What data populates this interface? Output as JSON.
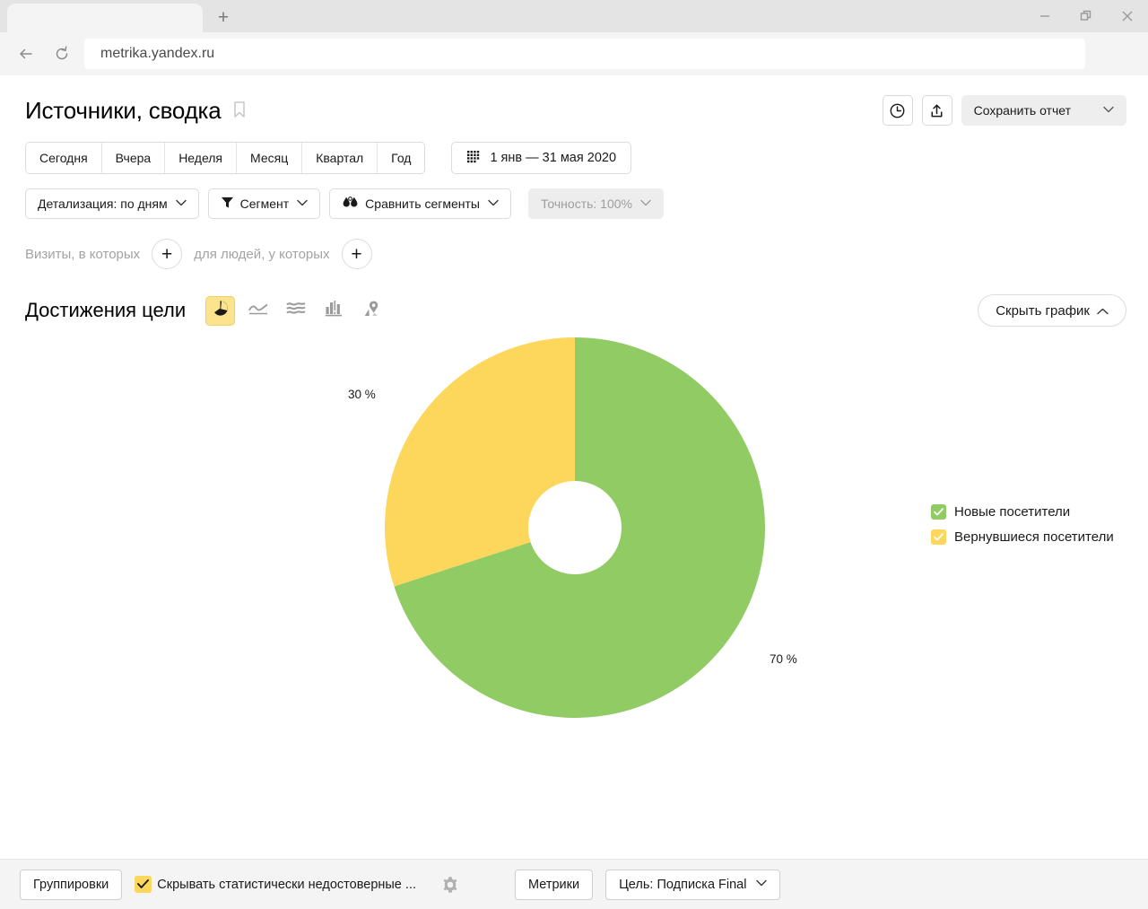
{
  "browser": {
    "tab_title": "",
    "newtab_label": "+",
    "url": "metrika.yandex.ru",
    "back_icon": "back-arrow-icon",
    "reload_icon": "reload-icon",
    "minimize_label": "–",
    "restore_label": "❐",
    "close_label": "✕"
  },
  "header": {
    "page_title": "Источники, сводка",
    "bookmark_icon": "bookmark-icon",
    "history_icon": "clock-icon",
    "share_icon": "share-icon",
    "save_report_label": "Сохранить отчет",
    "save_report_chevron": "⌄"
  },
  "period": {
    "buttons": [
      {
        "label": "Сегодня"
      },
      {
        "label": "Вчера"
      },
      {
        "label": "Неделя"
      },
      {
        "label": "Месяц"
      },
      {
        "label": "Квартал"
      },
      {
        "label": "Год"
      }
    ],
    "daterange_icon": "calendar-icon",
    "daterange_label": "1 янв — 31 мая 2020"
  },
  "tools": {
    "detail_label": "Детализация: по дням",
    "segment_icon": "funnel-icon",
    "segment_label": "Сегмент",
    "compare_icon": "droplets-icon",
    "compare_label": "Сравнить сегменты",
    "accuracy_label": "Точность: 100%",
    "chevron": "⌄"
  },
  "filters": {
    "visits_label": "Визиты, в которых",
    "people_label": "для людей, у которых",
    "add_label": "+"
  },
  "chart_section": {
    "title": "Достижения цели",
    "type_buttons": [
      {
        "name": "pie-chart-icon",
        "active": true
      },
      {
        "name": "line-chart-icon",
        "active": false
      },
      {
        "name": "area-chart-icon",
        "active": false
      },
      {
        "name": "bar-chart-icon",
        "active": false
      },
      {
        "name": "map-chart-icon",
        "active": false
      }
    ],
    "hide_chart_label": "Скрыть график",
    "hide_chart_chevron": "⌃"
  },
  "chart_data": {
    "type": "pie",
    "title": "Достижения цели",
    "donut": true,
    "categories": [
      "Новые посетители",
      "Вернувшиеся посетители"
    ],
    "values": [
      70,
      30
    ],
    "labels": [
      "70 %",
      "30 %"
    ],
    "colors": [
      "#90cc63",
      "#fcd75b"
    ],
    "legend_position": "right",
    "start_angle": 0,
    "direction": "clockwise"
  },
  "legend": {
    "items": [
      {
        "label": "Новые посетители",
        "color": "#90cc63",
        "checked": true
      },
      {
        "label": "Вернувшиеся посетители",
        "color": "#fcd75b",
        "checked": true
      }
    ]
  },
  "bottombar": {
    "groupings_label": "Группировки",
    "hide_unreliable_label": "Скрывать статистически недостоверные ...",
    "settings_icon": "gear-icon",
    "metrics_label": "Метрики",
    "goal_label": "Цель: Подписка Final",
    "goal_chevron": "⌄"
  }
}
